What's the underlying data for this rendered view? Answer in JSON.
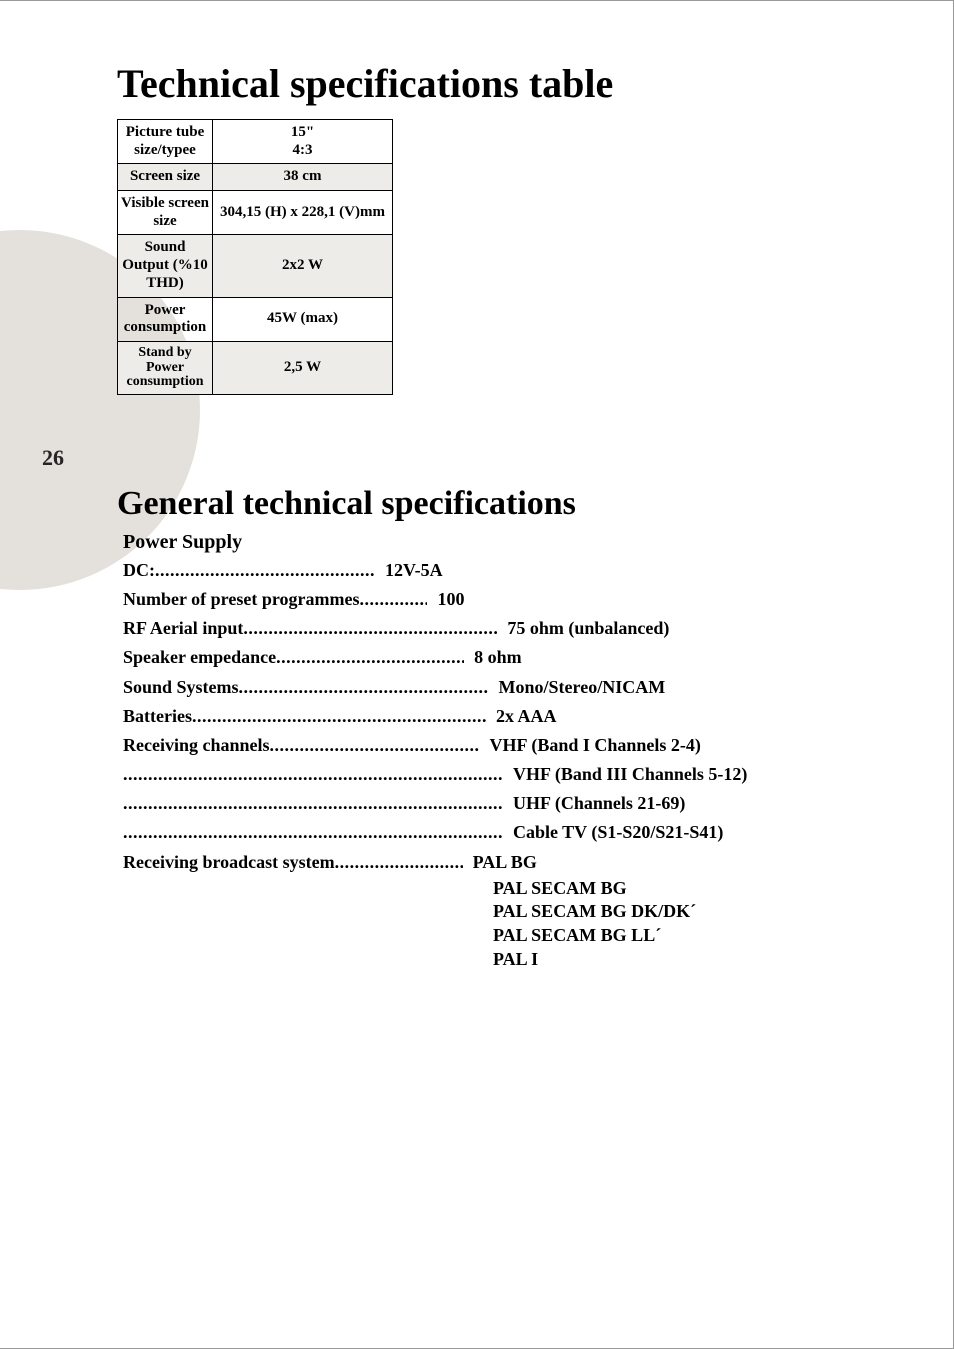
{
  "page_number": "26",
  "title1": "Technical  specifications table",
  "title2": "General technical  specifications",
  "spec_table": {
    "rows": [
      {
        "label": "Picture tube size/typee",
        "value": "15\"\n4:3"
      },
      {
        "label": "Screen size",
        "value": "38 cm"
      },
      {
        "label": "Visible screen size",
        "value": "304,15 (H) x 228,1 (V)mm"
      },
      {
        "label": "Sound Output (%10 THD)",
        "value": "2x2 W"
      },
      {
        "label": "Power consumption",
        "value": "45W (max)"
      },
      {
        "label": "Stand by Power consumption",
        "value": "2,5 W"
      }
    ]
  },
  "general": {
    "power_supply_heading": "Power Supply",
    "items": [
      {
        "label": "DC:",
        "value": "12V-5A",
        "dots": "w-long"
      },
      {
        "label": "Number of preset programmes",
        "value": "100",
        "dots": "w-presets"
      },
      {
        "label": "RF Aerial input",
        "value": "75 ohm (unbalanced)",
        "dots": "w-rf"
      },
      {
        "label": "Speaker empedance",
        "value": "8 ohm",
        "dots": "w-spk"
      },
      {
        "label": "Sound Systems",
        "value": "Mono/Stereo/NICAM",
        "dots": "w-sound"
      },
      {
        "label": "Batteries",
        "value": "2x AAA",
        "dots": "w-batt"
      },
      {
        "label": "Receiving channels",
        "value": "VHF (Band I Channels 2-4)",
        "dots": "w-recv"
      },
      {
        "label": "",
        "value": "VHF (Band III Channels 5-12)",
        "dots": "w-full"
      },
      {
        "label": "",
        "value": "UHF (Channels 21-69)",
        "dots": "w-full"
      },
      {
        "label": "",
        "value": "Cable TV (S1-S20/S21-S41)",
        "dots": "w-full"
      },
      {
        "label": "Receiving broadcast system",
        "value": "PAL BG",
        "dots": "w-rbs"
      }
    ],
    "broadcast_extra": [
      "PAL SECAM BG",
      "PAL SECAM BG DK/DK´",
      "PAL SECAM BG LL´",
      "PAL I"
    ]
  }
}
